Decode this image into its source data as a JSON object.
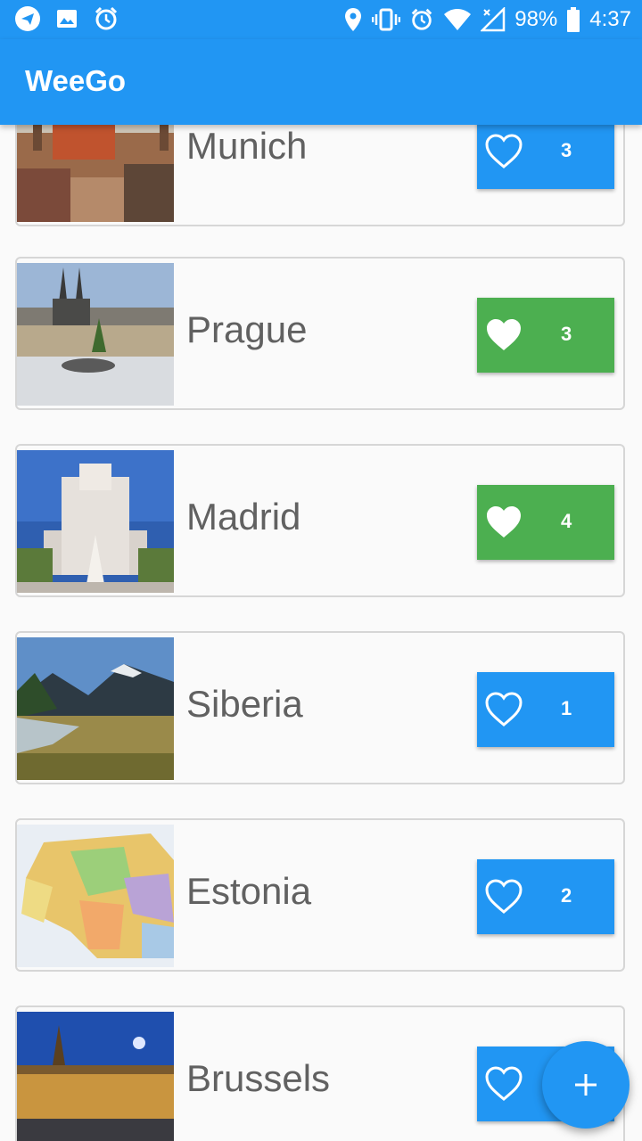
{
  "status_bar": {
    "battery": "98%",
    "time": "4:37",
    "icons_left": [
      "telegram-icon",
      "image-icon",
      "alarm-icon"
    ],
    "icons_right": [
      "location-icon",
      "vibrate-icon",
      "alarm-icon",
      "wifi-icon",
      "signal-icon",
      "battery-icon"
    ]
  },
  "app_bar": {
    "title": "WeeGo",
    "color": "#2196f3"
  },
  "colors": {
    "liked": "#4caf50",
    "not_liked": "#2196f3"
  },
  "places": [
    {
      "name": "Munich",
      "likes": "3",
      "liked": false
    },
    {
      "name": "Prague",
      "likes": "3",
      "liked": true
    },
    {
      "name": "Madrid",
      "likes": "4",
      "liked": true
    },
    {
      "name": "Siberia",
      "likes": "1",
      "liked": false
    },
    {
      "name": "Estonia",
      "likes": "2",
      "liked": false
    },
    {
      "name": "Brussels",
      "likes": "",
      "liked": false
    }
  ],
  "fab": {
    "icon": "plus-icon"
  }
}
